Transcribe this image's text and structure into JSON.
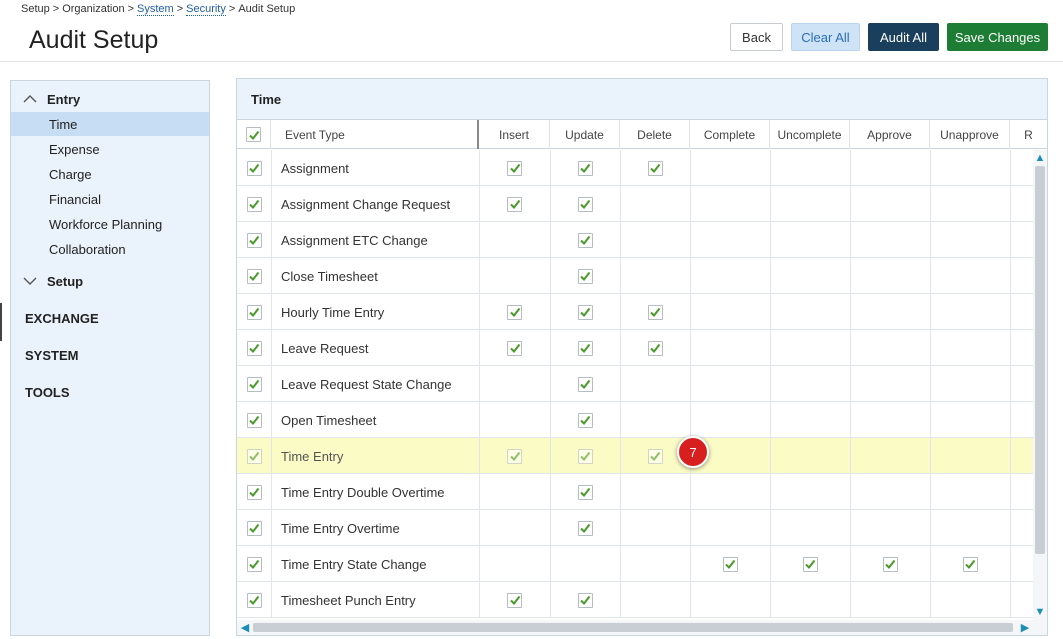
{
  "breadcrumb": {
    "items": [
      {
        "label": "Setup",
        "link": false
      },
      {
        "label": "Organization",
        "link": false
      },
      {
        "label": "System",
        "link": true
      },
      {
        "label": "Security",
        "link": true
      },
      {
        "label": "Audit Setup",
        "link": false
      }
    ],
    "separator": ">"
  },
  "page_title": "Audit Setup",
  "toolbar": {
    "back_label": "Back",
    "clear_all_label": "Clear All",
    "audit_all_label": "Audit All",
    "save_changes_label": "Save Changes"
  },
  "sidebar": {
    "entry_group": "Entry",
    "entry_items": [
      "Time",
      "Expense",
      "Charge",
      "Financial",
      "Workforce Planning",
      "Collaboration"
    ],
    "active_item": "Time",
    "setup_group": "Setup",
    "top_items": [
      "EXCHANGE",
      "SYSTEM",
      "TOOLS"
    ]
  },
  "panel": {
    "title": "Time",
    "columns": [
      "Event Type",
      "Insert",
      "Update",
      "Delete",
      "Complete",
      "Uncomplete",
      "Approve",
      "Unapprove",
      "R"
    ],
    "rows": [
      {
        "name": "Assignment",
        "insert": true,
        "update": true,
        "delete": true,
        "complete": false,
        "uncomplete": false,
        "approve": false,
        "unapprove": false
      },
      {
        "name": "Assignment Change Request",
        "insert": true,
        "update": true,
        "delete": false,
        "complete": false,
        "uncomplete": false,
        "approve": false,
        "unapprove": false
      },
      {
        "name": "Assignment ETC Change",
        "insert": false,
        "update": true,
        "delete": false,
        "complete": false,
        "uncomplete": false,
        "approve": false,
        "unapprove": false
      },
      {
        "name": "Close Timesheet",
        "insert": false,
        "update": true,
        "delete": false,
        "complete": false,
        "uncomplete": false,
        "approve": false,
        "unapprove": false
      },
      {
        "name": "Hourly Time Entry",
        "insert": true,
        "update": true,
        "delete": true,
        "complete": false,
        "uncomplete": false,
        "approve": false,
        "unapprove": false
      },
      {
        "name": "Leave Request",
        "insert": true,
        "update": true,
        "delete": true,
        "complete": false,
        "uncomplete": false,
        "approve": false,
        "unapprove": false
      },
      {
        "name": "Leave Request State Change",
        "insert": false,
        "update": true,
        "delete": false,
        "complete": false,
        "uncomplete": false,
        "approve": false,
        "unapprove": false
      },
      {
        "name": "Open Timesheet",
        "insert": false,
        "update": true,
        "delete": false,
        "complete": false,
        "uncomplete": false,
        "approve": false,
        "unapprove": false
      },
      {
        "name": "Time Entry",
        "insert": true,
        "update": true,
        "delete": true,
        "complete": false,
        "uncomplete": false,
        "approve": false,
        "unapprove": false,
        "highlight": true
      },
      {
        "name": "Time Entry Double Overtime",
        "insert": false,
        "update": true,
        "delete": false,
        "complete": false,
        "uncomplete": false,
        "approve": false,
        "unapprove": false
      },
      {
        "name": "Time Entry Overtime",
        "insert": false,
        "update": true,
        "delete": false,
        "complete": false,
        "uncomplete": false,
        "approve": false,
        "unapprove": false
      },
      {
        "name": "Time Entry State Change",
        "insert": false,
        "update": false,
        "delete": false,
        "complete": true,
        "uncomplete": true,
        "approve": true,
        "unapprove": true
      },
      {
        "name": "Timesheet Punch Entry",
        "insert": true,
        "update": true,
        "delete": false,
        "complete": false,
        "uncomplete": false,
        "approve": false,
        "unapprove": false
      }
    ]
  },
  "callout": {
    "number": "7"
  },
  "colors": {
    "check": "#4a9a2a",
    "highlight": "#fbfbc6",
    "callout": "#d81f1f",
    "audit_all": "#1a3f5c",
    "save": "#1e7d34"
  }
}
